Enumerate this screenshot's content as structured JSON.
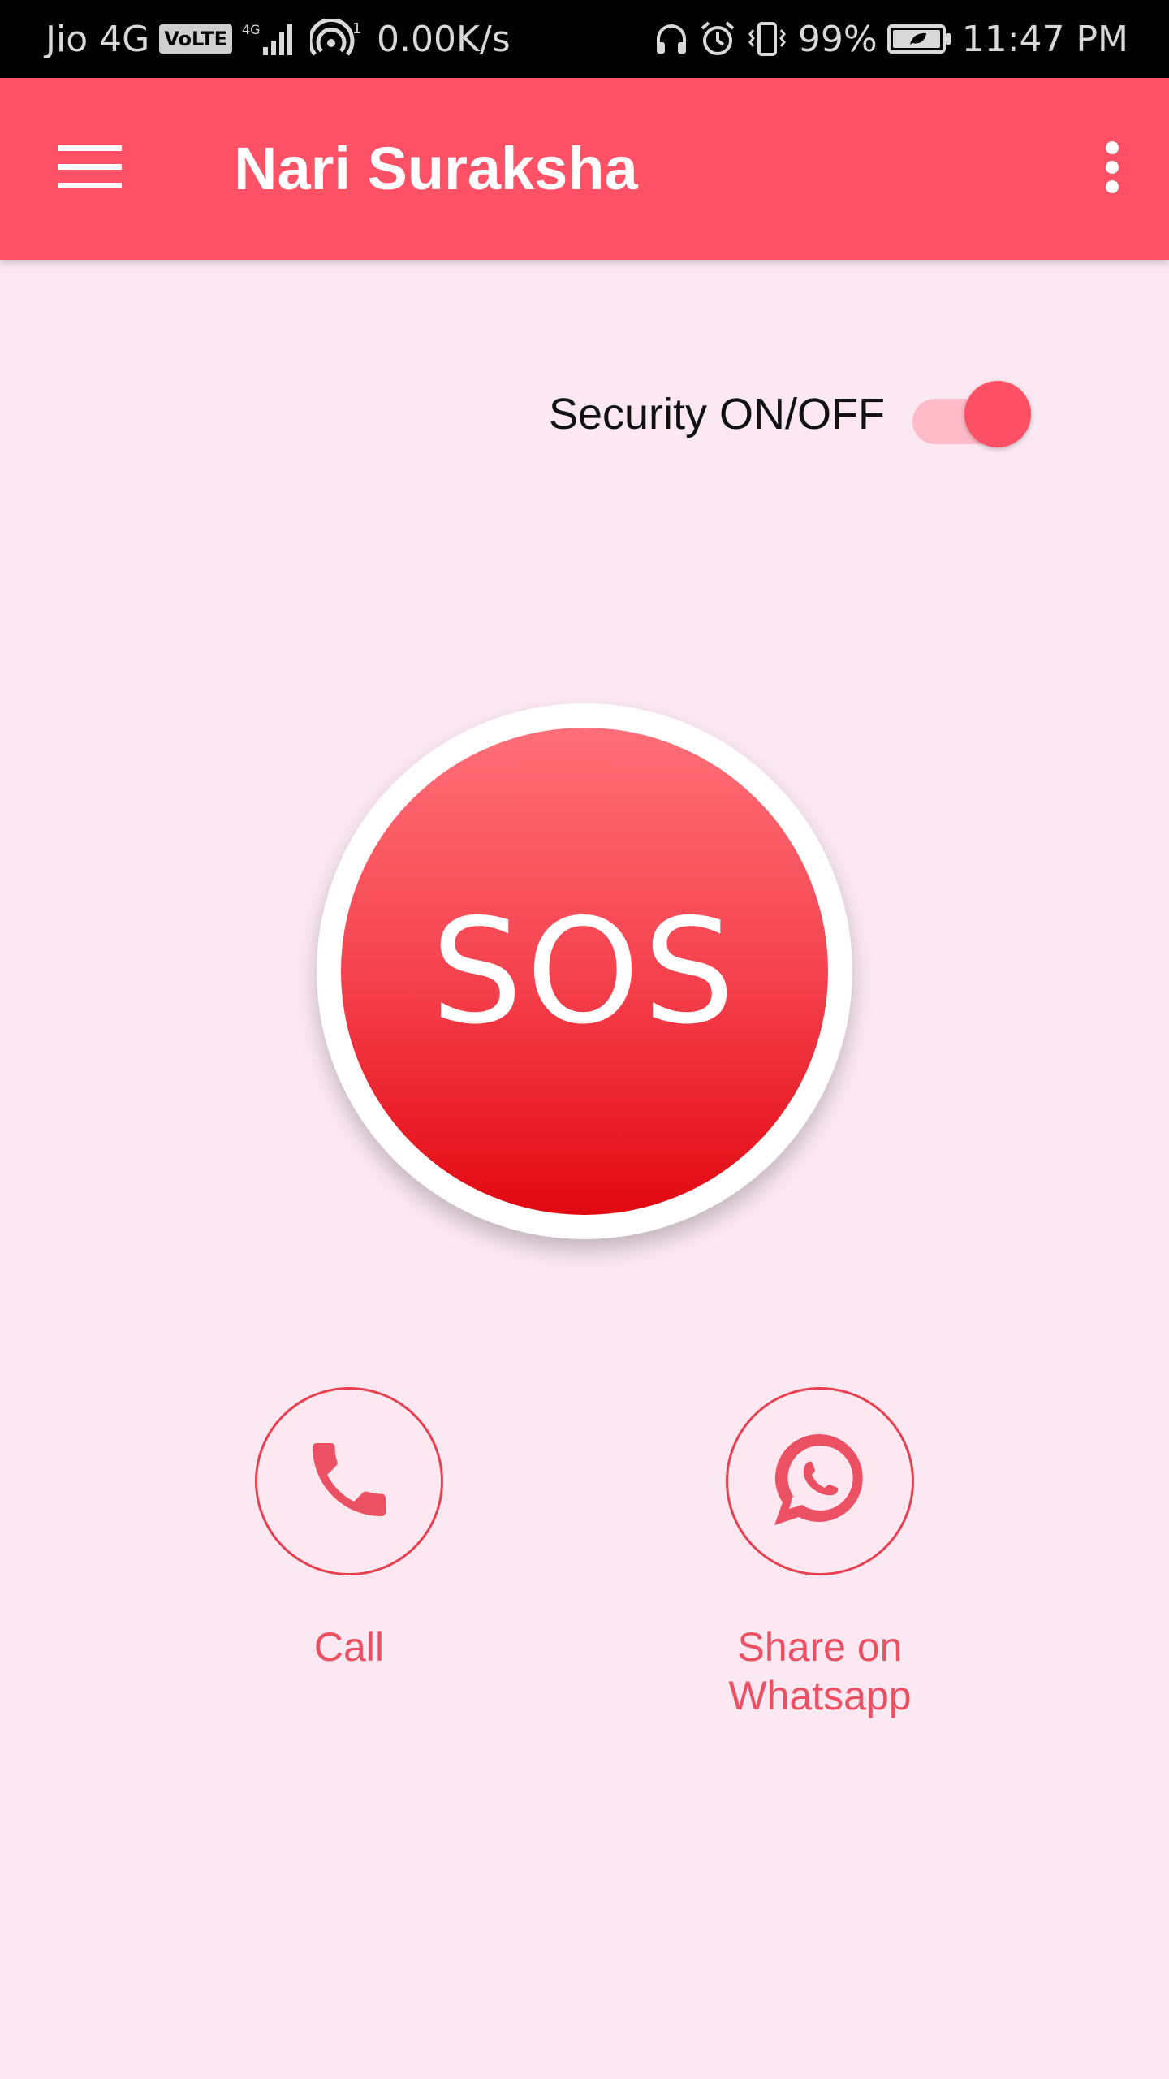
{
  "status_bar": {
    "carrier": "Jio 4G",
    "volte": "VoLTE",
    "network_type": "4G",
    "hotspot_count": "1",
    "speed": "0.00K/s",
    "battery": "99%",
    "time": "11:47 PM"
  },
  "app_bar": {
    "title": "Nari Suraksha"
  },
  "security": {
    "label": "Security ON/OFF",
    "enabled": true
  },
  "sos": {
    "label": "SOS"
  },
  "actions": {
    "call_label": "Call",
    "share_label": "Share on Whatsapp"
  },
  "colors": {
    "primary": "#fe5165",
    "background": "#fbe8f2",
    "sos_top": "#ff6f78",
    "sos_bottom": "#e20810",
    "accent_text": "#ec5063"
  },
  "icons": {
    "menu": "hamburger-menu-icon",
    "overflow": "more-vert-icon",
    "call": "phone-icon",
    "share": "whatsapp-icon"
  }
}
